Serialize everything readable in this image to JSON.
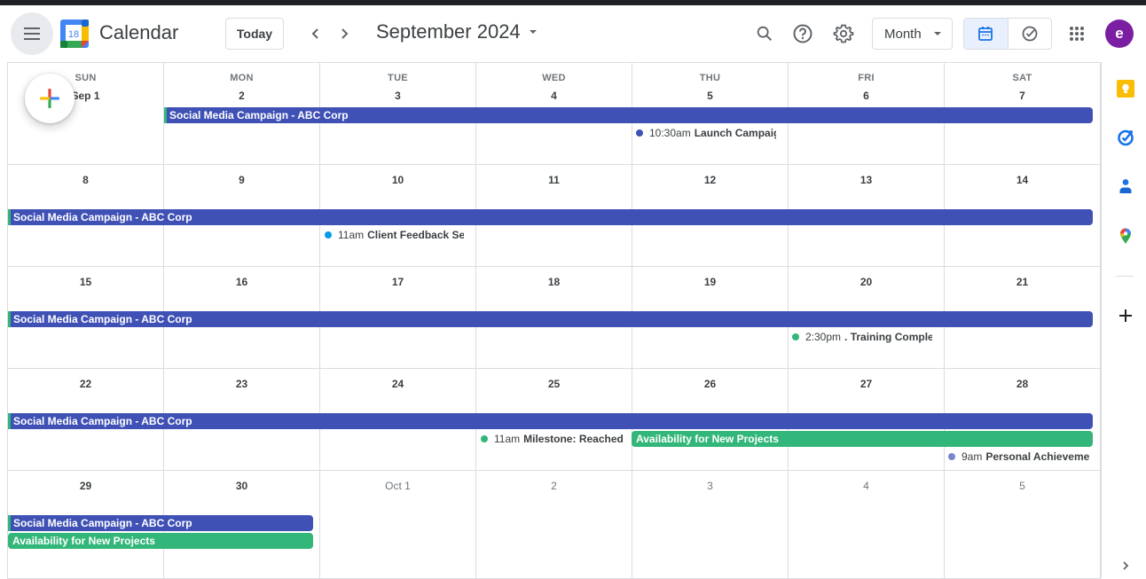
{
  "header": {
    "app_title": "Calendar",
    "logo_date": "18",
    "today_label": "Today",
    "month_title": "September 2024",
    "view_select": "Month",
    "avatar_letter": "e",
    "colors": {
      "avatar": "#7b1fa2",
      "accent": "#1a73e8"
    }
  },
  "grid": {
    "weekday_labels": [
      "SUN",
      "MON",
      "TUE",
      "WED",
      "THU",
      "FRI",
      "SAT"
    ],
    "weeks": [
      [
        "Sep 1",
        "2",
        "3",
        "4",
        "5",
        "6",
        "7"
      ],
      [
        "8",
        "9",
        "10",
        "11",
        "12",
        "13",
        "14"
      ],
      [
        "15",
        "16",
        "17",
        "18",
        "19",
        "20",
        "21"
      ],
      [
        "22",
        "23",
        "24",
        "25",
        "26",
        "27",
        "28"
      ],
      [
        "29",
        "30",
        "Oct 1",
        "2",
        "3",
        "4",
        "5"
      ]
    ]
  },
  "events": {
    "social_media": "Social Media Campaign - ABC Corp",
    "availability": "Availability for New Projects",
    "launch": {
      "time": "10:30am",
      "title": "Launch Campaign"
    },
    "client_feedback": {
      "time": "11am",
      "title": "Client Feedback Session"
    },
    "training": {
      "time": "2:30pm",
      "title": ". Training Completion"
    },
    "milestone": {
      "time": "11am",
      "title": "Milestone: Reached"
    },
    "personal": {
      "time": "9am",
      "title": "Personal Achievement"
    },
    "colors": {
      "blue": "#3f51b5",
      "green": "#33b679",
      "cyan": "#039be5",
      "lavender": "#7986cb"
    }
  },
  "side_panel": {
    "icons": [
      "keep-icon",
      "tasks-icon",
      "contacts-icon",
      "maps-icon",
      "add-icon"
    ]
  }
}
